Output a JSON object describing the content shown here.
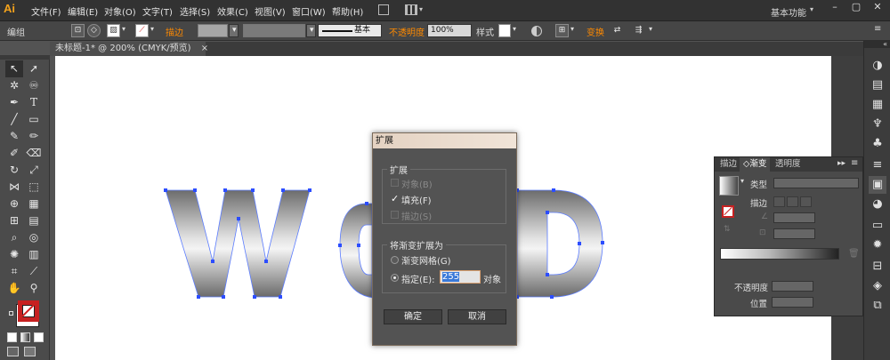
{
  "app": {
    "logo": "Ai",
    "workspace": "基本功能"
  },
  "menu": [
    "文件(F)",
    "编辑(E)",
    "对象(O)",
    "文字(T)",
    "选择(S)",
    "效果(C)",
    "视图(V)",
    "窗口(W)",
    "帮助(H)"
  ],
  "window_buttons": [
    "–",
    "▢",
    "✕"
  ],
  "control": {
    "selection": "编组",
    "stroke_label": "描边",
    "stroke_style": "基本",
    "opacity_label": "不透明度",
    "opacity_value": "100%",
    "style_label": "样式",
    "transform_label": "变换"
  },
  "document_tab": {
    "title": "未标题-1* @ 200% (CMYK/预览)",
    "close": "×"
  },
  "canvas": {
    "art_letters": [
      "W",
      "O",
      "D"
    ]
  },
  "gradient_panel": {
    "tabs": [
      "描边",
      "渐变",
      "透明度"
    ],
    "type_label": "类型",
    "stroke_label": "描边",
    "opacity_label": "不透明度",
    "position_label": "位置"
  },
  "dialog": {
    "title": "扩展",
    "expand_group": "扩展",
    "object_option": "对象(B)",
    "fill_option": "填充(F)",
    "stroke_option": "描边(S)",
    "gradient_group": "将渐变扩展为",
    "mesh_option": "渐变网格(G)",
    "specify_option": "指定(E):",
    "specify_value": "255",
    "objects_label": "对象",
    "ok": "确定",
    "cancel": "取消"
  }
}
